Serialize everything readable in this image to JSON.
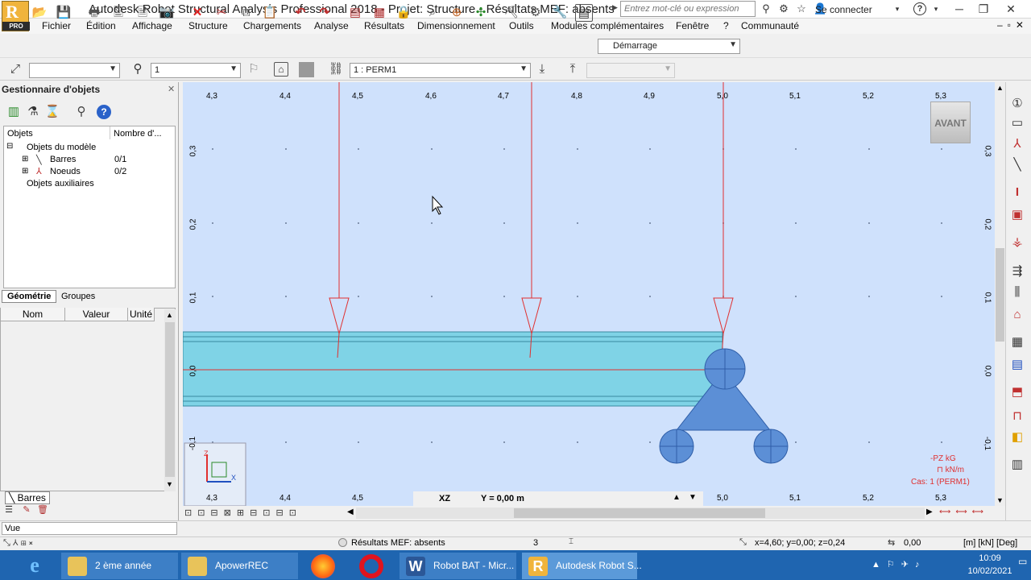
{
  "app": {
    "logo_letter": "R",
    "logo_badge": "PRO",
    "title": "Autodesk Robot Structural Analysis Professional 2018 - Projet: Structure - Résultats MEF: absents",
    "search_placeholder": "Entrez mot-clé ou expression",
    "login_label": "Se connecter"
  },
  "menu": [
    "Fichier",
    "Édition",
    "Affichage",
    "Structure",
    "Chargements",
    "Analyse",
    "Résultats",
    "Dimensionnement",
    "Outils",
    "Modules complémentaires",
    "Fenêtre",
    "?",
    "Communauté"
  ],
  "toolbar": {
    "layout_select": "Démarrage",
    "case_number": "1",
    "load_case": "1 : PERM1"
  },
  "object_manager": {
    "title": "Gestionnaire d'objets",
    "col_objects": "Objets",
    "col_count": "Nombre d'...",
    "root": "Objets du modèle",
    "bars_label": "Barres",
    "bars_count": "0/1",
    "nodes_label": "Noeuds",
    "nodes_count": "0/2",
    "aux_label": "Objets auxiliaires",
    "tab_geometry": "Géométrie",
    "tab_groups": "Groupes",
    "prop_name": "Nom",
    "prop_value": "Valeur",
    "prop_unit": "Unité",
    "bottom_tab": "Barres"
  },
  "view": {
    "x_ticks": [
      "4,3",
      "4,4",
      "4,5",
      "4,6",
      "4,7",
      "4,8",
      "4,9",
      "5,0",
      "5,1",
      "5,2",
      "5,3"
    ],
    "z_ticks": [
      "0,3",
      "0,2",
      "0,1",
      "0,0",
      "-0,1"
    ],
    "view_cube_label": "AVANT",
    "plane": "XZ",
    "plane_coord": "Y = 0,00 m",
    "legend_load": "-PZ   kG",
    "legend_unit": "kN/m",
    "legend_case": "Cas: 1 (PERM1)"
  },
  "status": {
    "view_label": "Vue",
    "results": "Résultats MEF: absents",
    "counter": "3",
    "coords": "x=4,60; y=0,00; z=0,24",
    "value": "0,00",
    "units": "[m] [kN] [Deg]"
  },
  "taskbar": {
    "items": [
      "2 ème année",
      "ApowerREC",
      "Robot BAT - Micr...",
      "Autodesk Robot S..."
    ],
    "time": "10:09",
    "date": "10/02/2021"
  }
}
